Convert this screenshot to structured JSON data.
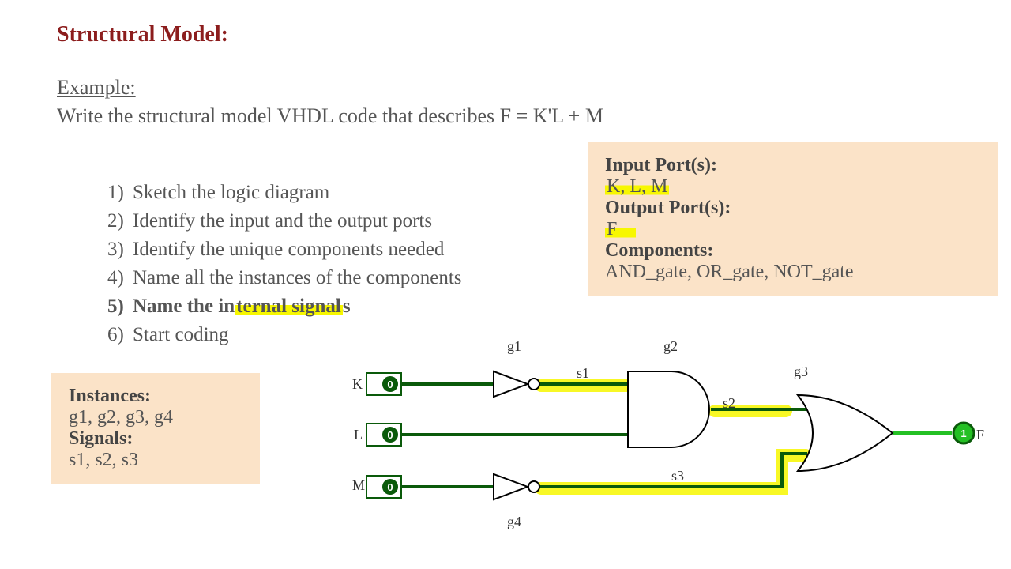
{
  "title": "Structural Model:",
  "example": "Example:",
  "prompt": "Write the structural model VHDL code that describes F = K'L + M",
  "steps": {
    "s1": {
      "n": "1)",
      "t": "Sketch the logic diagram"
    },
    "s2": {
      "n": "2)",
      "t": "Identify the input and the output ports"
    },
    "s3": {
      "n": "3)",
      "t": "Identify the unique components needed"
    },
    "s4": {
      "n": "4)",
      "t": "Name all the instances of the components"
    },
    "s5": {
      "n": "5)",
      "pre": "Name the in",
      "hl": "ternal signal",
      "post": "s"
    },
    "s6": {
      "n": "6)",
      "t": "Start coding"
    }
  },
  "right_box": {
    "in_hdr": "Input Port(s):",
    "in_val": "K, L, M",
    "out_hdr": "Output Port(s):",
    "out_val": "F",
    "comp_hdr": "Components:",
    "comp_val": "AND_gate, OR_gate, NOT_gate"
  },
  "left_box": {
    "inst_hdr": "Instances:",
    "inst_val": "g1, g2, g3, g4",
    "sig_hdr": "Signals:",
    "sig_val": "s1, s2, s3"
  },
  "circuit": {
    "K": "K",
    "L": "L",
    "M": "M",
    "F": "F",
    "z": "0",
    "one": "1",
    "g1": "g1",
    "g2": "g2",
    "g3": "g3",
    "g4": "g4",
    "s1": "s1",
    "s2": "s2",
    "s3": "s3"
  }
}
